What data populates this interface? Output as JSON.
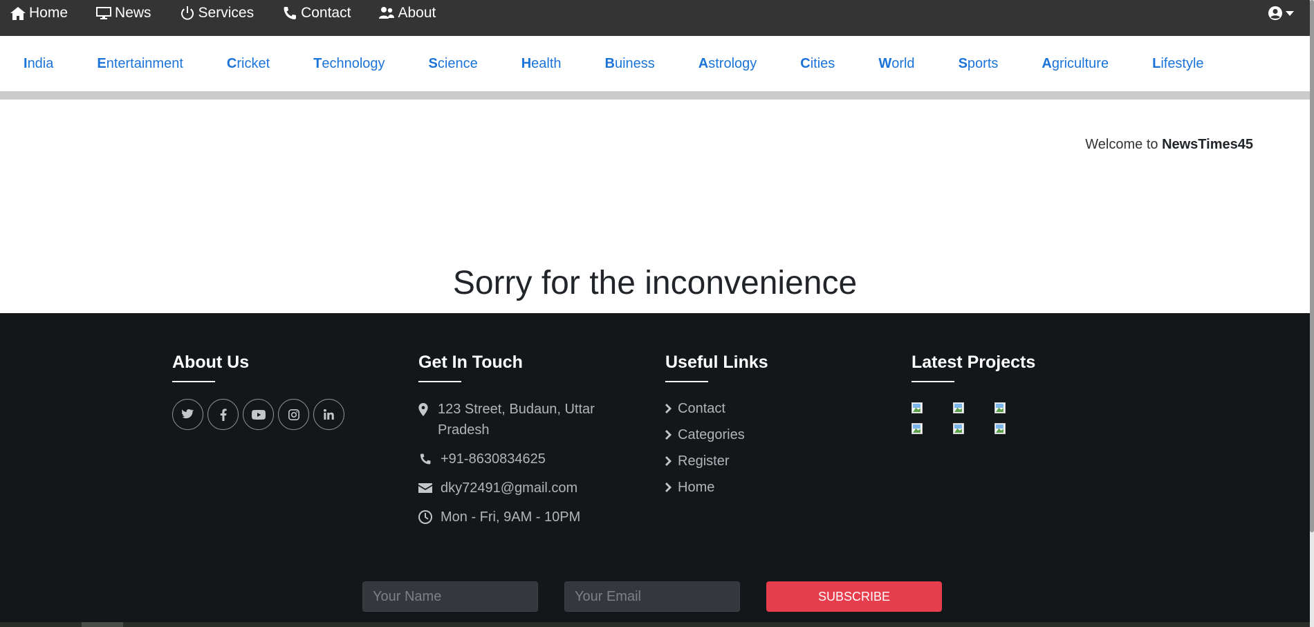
{
  "topnav": {
    "items": [
      {
        "label": "Home",
        "icon": "home-icon"
      },
      {
        "label": "News",
        "icon": "monitor-icon"
      },
      {
        "label": "Services",
        "icon": "power-icon"
      },
      {
        "label": "Contact",
        "icon": "phone-icon"
      },
      {
        "label": "About",
        "icon": "users-icon"
      }
    ],
    "user_icon": "user-circle-icon"
  },
  "categories": [
    {
      "initial": "I",
      "rest": "ndia"
    },
    {
      "initial": "E",
      "rest": "ntertainment"
    },
    {
      "initial": "C",
      "rest": "ricket"
    },
    {
      "initial": "T",
      "rest": "echnology"
    },
    {
      "initial": "S",
      "rest": "cience"
    },
    {
      "initial": "H",
      "rest": "ealth"
    },
    {
      "initial": "B",
      "rest": "uiness"
    },
    {
      "initial": "A",
      "rest": "strology"
    },
    {
      "initial": "C",
      "rest": "ities"
    },
    {
      "initial": "W",
      "rest": "orld"
    },
    {
      "initial": "S",
      "rest": "ports"
    },
    {
      "initial": "A",
      "rest": "griculture"
    },
    {
      "initial": "L",
      "rest": "ifestyle"
    }
  ],
  "welcome": {
    "prefix": "Welcome to ",
    "site": "NewsTimes45"
  },
  "main": {
    "message": "Sorry for the inconvenience"
  },
  "footer": {
    "about": {
      "title": "About Us",
      "socials": [
        "twitter-icon",
        "facebook-icon",
        "youtube-icon",
        "instagram-icon",
        "linkedin-icon"
      ]
    },
    "contact": {
      "title": "Get In Touch",
      "address": "123 Street, Budaun, Uttar Pradesh",
      "phone": "+91-8630834625",
      "email": "dky72491@gmail.com",
      "hours": "Mon - Fri, 9AM - 10PM"
    },
    "links": {
      "title": "Useful Links",
      "items": [
        "Contact",
        "Categories",
        "Register",
        "Home"
      ]
    },
    "projects": {
      "title": "Latest Projects"
    },
    "subscribe": {
      "name_placeholder": "Your Name",
      "email_placeholder": "Your Email",
      "button": "SUBSCRIBE"
    }
  },
  "colors": {
    "accent": "#1a73d9",
    "subscribe": "#e63e4c",
    "footer_bg": "#14171a",
    "topbar_bg": "#343434"
  }
}
